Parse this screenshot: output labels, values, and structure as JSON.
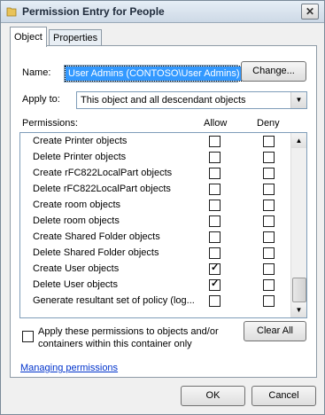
{
  "window": {
    "title": "Permission Entry for People",
    "close_glyph": "✕"
  },
  "tabs": [
    {
      "label": "Object",
      "active": true
    },
    {
      "label": "Properties",
      "active": false
    }
  ],
  "name": {
    "label": "Name:",
    "value": "User Admins (CONTOSO\\User Admins)",
    "change_label": "Change..."
  },
  "apply_to": {
    "label": "Apply to:",
    "value": "This object and all descendant objects",
    "dropdown_glyph": "▼"
  },
  "permissions": {
    "label": "Permissions:",
    "allow_header": "Allow",
    "deny_header": "Deny",
    "rows": [
      {
        "name": "Create Printer objects",
        "allow": false,
        "deny": false
      },
      {
        "name": "Delete Printer objects",
        "allow": false,
        "deny": false
      },
      {
        "name": "Create rFC822LocalPart objects",
        "allow": false,
        "deny": false
      },
      {
        "name": "Delete rFC822LocalPart objects",
        "allow": false,
        "deny": false
      },
      {
        "name": "Create room objects",
        "allow": false,
        "deny": false
      },
      {
        "name": "Delete room objects",
        "allow": false,
        "deny": false
      },
      {
        "name": "Create Shared Folder objects",
        "allow": false,
        "deny": false
      },
      {
        "name": "Delete Shared Folder objects",
        "allow": false,
        "deny": false
      },
      {
        "name": "Create User objects",
        "allow": true,
        "deny": false
      },
      {
        "name": "Delete User objects",
        "allow": true,
        "deny": false
      },
      {
        "name": "Generate resultant set of policy (log...",
        "allow": false,
        "deny": false
      }
    ],
    "scroll_up_glyph": "▲",
    "scroll_down_glyph": "▼"
  },
  "apply_checkbox": {
    "label_line1": "Apply these permissions to objects and/or",
    "label_line2": "containers within this container only",
    "checked": false
  },
  "clear_all_label": "Clear All",
  "managing_link": "Managing permissions",
  "footer": {
    "ok_label": "OK",
    "cancel_label": "Cancel"
  },
  "colors": {
    "selection": "#3399ff",
    "link": "#0033cc"
  }
}
